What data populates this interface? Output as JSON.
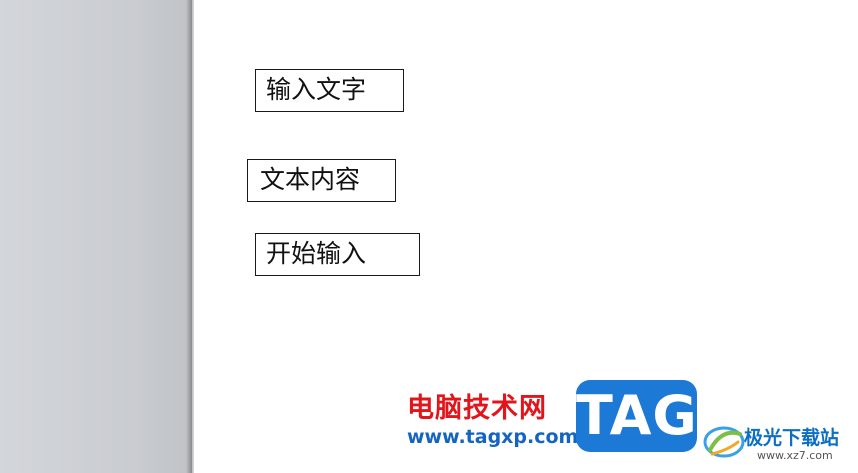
{
  "document": {
    "textboxes": [
      {
        "text": "输入文字"
      },
      {
        "text": "文本内容"
      },
      {
        "text": "开始输入"
      }
    ]
  },
  "watermark": {
    "site_name": "电脑技术网",
    "site_url": "www.tagxp.com",
    "logo_text": "TAG",
    "logo_color": "#1d79d6",
    "secondary_name": "极光下载站",
    "secondary_url": "www.xz7.com",
    "secondary_icon": "aurora-swirl-icon"
  }
}
